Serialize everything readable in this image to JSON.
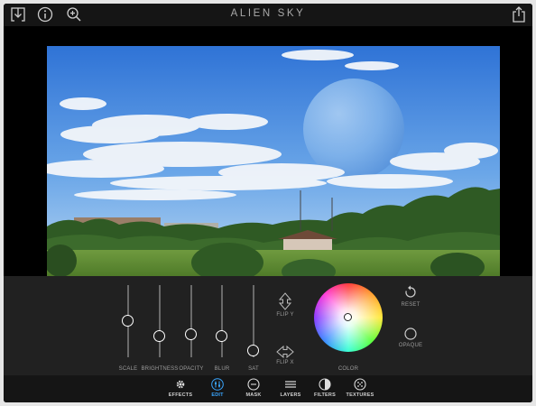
{
  "app": {
    "title": "ALIEN SKY"
  },
  "toolbar": {
    "icons": [
      "download-icon",
      "info-icon",
      "zoom-icon",
      "share-icon"
    ]
  },
  "edit_panel": {
    "sliders": [
      {
        "label": "SCALE",
        "value": 0.5
      },
      {
        "label": "BRIGHTNESS",
        "value": 0.25
      },
      {
        "label": "OPACITY",
        "value": 0.27
      },
      {
        "label": "BLUR",
        "value": 0.25
      },
      {
        "label": "SAT",
        "value": 0.0
      }
    ],
    "flip_y": "FLIP Y",
    "flip_x": "FLIP X",
    "color_label": "COLOR",
    "reset_label": "RESET",
    "opaque_label": "OPAQUE"
  },
  "tabs": [
    {
      "label": "EFFECTS",
      "icon": "gear-icon",
      "active": false
    },
    {
      "label": "EDIT",
      "icon": "sliders-icon",
      "active": true
    },
    {
      "label": "MASK",
      "icon": "mask-icon",
      "active": false
    },
    {
      "label": "LAYERS",
      "icon": "layers-icon",
      "active": false
    },
    {
      "label": "FILTERS",
      "icon": "filters-icon",
      "active": false
    },
    {
      "label": "TEXTURES",
      "icon": "textures-icon",
      "active": false
    }
  ],
  "colors": {
    "accent": "#3aa6ff",
    "background": "#000000",
    "panel": "#212121"
  }
}
